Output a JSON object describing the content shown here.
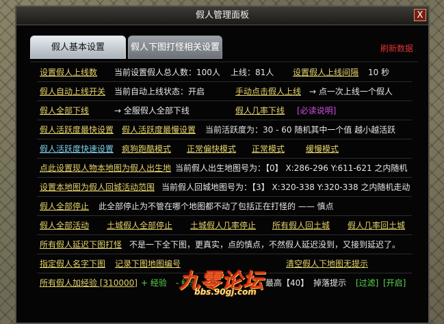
{
  "window": {
    "title": "假人管理面板",
    "close_label": "X"
  },
  "tabs": [
    {
      "label": "假人基本设置"
    },
    {
      "label": "假人下图打怪相关设置"
    }
  ],
  "refresh_label": "刷新数据",
  "rows": [
    [
      {
        "text": "设置假人上线数",
        "kind": "lk"
      },
      {
        "text": "当前设置假人总人数：100人",
        "kind": "tx"
      },
      {
        "text": "上线：81人",
        "kind": "tx"
      },
      {
        "text": "设置假人上线间隔",
        "kind": "lk"
      },
      {
        "text": "10 秒",
        "kind": "tx"
      }
    ],
    [
      {
        "text": "假人自动上线开关",
        "kind": "lk"
      },
      {
        "text": "当前自动上线状态：开启",
        "kind": "tx"
      },
      {
        "text": "手动点击假人上线",
        "kind": "lk"
      },
      {
        "text": "→ 点一次上线一个假人",
        "kind": "tx"
      }
    ],
    [
      {
        "text": "假人全部下线",
        "kind": "lk"
      },
      {
        "text": "→ 全服假人全部下线",
        "kind": "tx"
      },
      {
        "text": "假人几率下线",
        "kind": "lk"
      },
      {
        "text": "[必读说明]",
        "kind": "mag"
      }
    ],
    [
      {
        "text": "假人活跃度最快设置",
        "kind": "lk"
      },
      {
        "text": "假人活跃度最慢设置",
        "kind": "lk"
      },
      {
        "text": "当前活跃度为：30 - 60 随机其中一个值 越小越活跃",
        "kind": "tx"
      }
    ],
    [
      {
        "text": "假人活跃度快速设置",
        "kind": "lk blue"
      },
      {
        "text": "疯狗跑酷模式",
        "kind": "lk"
      },
      {
        "text": "正常偏快模式",
        "kind": "lk"
      },
      {
        "text": "正常模式",
        "kind": "lk"
      },
      {
        "text": "缓慢模式",
        "kind": "lk"
      }
    ],
    [
      {
        "text": "点此设置现人物本地图为假人出生地",
        "kind": "lk"
      },
      {
        "text": "当前假人出生地图号为：【0】 X:286-296 Y:611-621 之内随机",
        "kind": "tx"
      }
    ],
    [
      {
        "text": "设置本地图为假人回城活动范围",
        "kind": "lk"
      },
      {
        "text": "当前假人回城地图号为：【3】 X:320-338 Y:320-338 之内随机走动",
        "kind": "tx"
      }
    ],
    [
      {
        "text": "假人全部停止",
        "kind": "lk"
      },
      {
        "text": "此全部停止为不管在哪个地图都不动了包括正在打怪的 —— 慎点",
        "kind": "tx"
      }
    ],
    [
      {
        "text": "假人全部活动",
        "kind": "lk"
      },
      {
        "text": "土城假人全部停止",
        "kind": "lk"
      },
      {
        "text": "土城假人几率停止",
        "kind": "lk"
      },
      {
        "text": "所有假人回土城",
        "kind": "lk"
      },
      {
        "text": "假人几率回土城",
        "kind": "lk"
      }
    ],
    [
      {
        "text": "所有假人延迟下图打怪",
        "kind": "lk"
      },
      {
        "text": "不是一下全下图，更真实，点的慎点，不然假人延迟没到，又接到延迟了。",
        "kind": "tx"
      }
    ],
    [
      {
        "text": "指定假人名字下图",
        "kind": "lk"
      },
      {
        "text": "记录下图地图编号",
        "kind": "lk"
      },
      {
        "text": "清空假人下地图无提示",
        "kind": "lk"
      }
    ],
    [
      {
        "text": "所有假人加经验 [310000]",
        "kind": "lk"
      },
      {
        "text": "+ 经验",
        "kind": "grn"
      },
      {
        "text": "- 经验",
        "kind": "grn"
      },
      {
        "text": "最高【40】",
        "kind": "tx"
      },
      {
        "text": "掉落提示",
        "kind": "tx"
      },
      {
        "text": "[过滤]",
        "kind": "grn"
      },
      {
        "text": "[开启]",
        "kind": "grn"
      }
    ]
  ],
  "watermark": {
    "text": "九零论坛",
    "url": "bbs.90gj.com"
  }
}
